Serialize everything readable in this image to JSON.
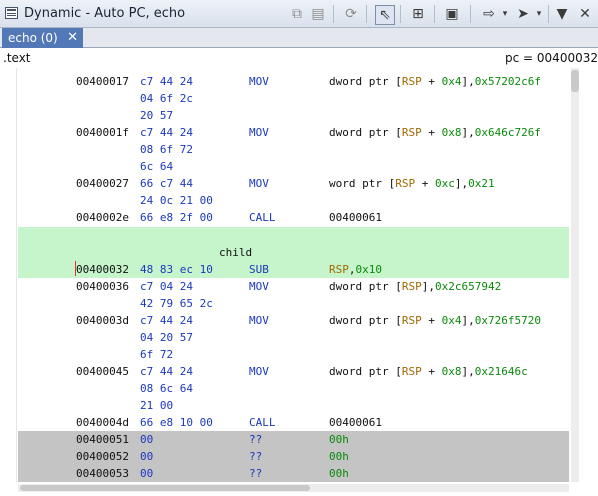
{
  "window": {
    "title": "Dynamic - Auto PC, echo"
  },
  "toolbar": {
    "icons": [
      "copy-icon",
      "paste-icon",
      "refresh-icon",
      "cursor-select-icon",
      "stack-export-icon",
      "snapshot-icon",
      "goto-arrow-icon",
      "navigate-icon",
      "menu-dropdown-icon",
      "close-icon"
    ]
  },
  "tab": {
    "label": "echo (0)",
    "close_glyph": "✕"
  },
  "info": {
    "section": ".text",
    "pc_label": "pc = 00400032"
  },
  "listing": {
    "label_child": "child",
    "rows": [
      {
        "addr": "00400017",
        "bytes": "c7 44 24",
        "mn": "MOV",
        "op_pre": "dword ptr [",
        "reg": "RSP",
        "op_mid": " + ",
        "num": "0x4",
        "op_end": "],",
        "num2": "0x57202c6f"
      },
      {
        "bytes": "04 6f 2c"
      },
      {
        "bytes": "20 57"
      },
      {
        "addr": "0040001f",
        "bytes": "c7 44 24",
        "mn": "MOV",
        "op_pre": "dword ptr [",
        "reg": "RSP",
        "op_mid": " + ",
        "num": "0x8",
        "op_end": "],",
        "num2": "0x646c726f"
      },
      {
        "bytes": "08 6f 72"
      },
      {
        "bytes": "6c 64"
      },
      {
        "addr": "00400027",
        "bytes": "66 c7 44",
        "mn": "MOV",
        "op_pre": "word ptr [",
        "reg": "RSP",
        "op_mid": " + ",
        "num": "0xc",
        "op_end": "],",
        "num2": "0x21"
      },
      {
        "bytes": "24 0c 21 00"
      },
      {
        "addr": "0040002e",
        "bytes": "66 e8 2f 00",
        "mn": "CALL",
        "target": "00400061"
      },
      {
        "addr": "00400032",
        "bytes": "48 83 ec 10",
        "mn": "SUB",
        "reg": "RSP",
        "sep": ",",
        "num": "0x10"
      },
      {
        "addr": "00400036",
        "bytes": "c7 04 24",
        "mn": "MOV",
        "op_pre": "dword ptr [",
        "reg": "RSP",
        "op_end": "],",
        "num2": "0x2c657942"
      },
      {
        "bytes": "42 79 65 2c"
      },
      {
        "addr": "0040003d",
        "bytes": "c7 44 24",
        "mn": "MOV",
        "op_pre": "dword ptr [",
        "reg": "RSP",
        "op_mid": " + ",
        "num": "0x4",
        "op_end": "],",
        "num2": "0x726f5720"
      },
      {
        "bytes": "04 20 57"
      },
      {
        "bytes": "6f 72"
      },
      {
        "addr": "00400045",
        "bytes": "c7 44 24",
        "mn": "MOV",
        "op_pre": "dword ptr [",
        "reg": "RSP",
        "op_mid": " + ",
        "num": "0x8",
        "op_end": "],",
        "num2": "0x21646c"
      },
      {
        "bytes": "08 6c 64"
      },
      {
        "bytes": "21 00"
      },
      {
        "addr": "0040004d",
        "bytes": "66 e8 10 00",
        "mn": "CALL",
        "target": "00400061"
      },
      {
        "addr": "00400051",
        "bytes": "00",
        "mn": "??",
        "num": "00h"
      },
      {
        "addr": "00400052",
        "bytes": "00",
        "mn": "??",
        "num": "00h"
      },
      {
        "addr": "00400053",
        "bytes": "00",
        "mn": "??",
        "num": "00h"
      }
    ]
  },
  "colors": {
    "highlight_pc": "#c6f5cc",
    "undefined_bytes": "#c4c4c4",
    "mnemonic": "#1b38c0",
    "register": "#a06800",
    "scalar": "#0a8a0a"
  }
}
